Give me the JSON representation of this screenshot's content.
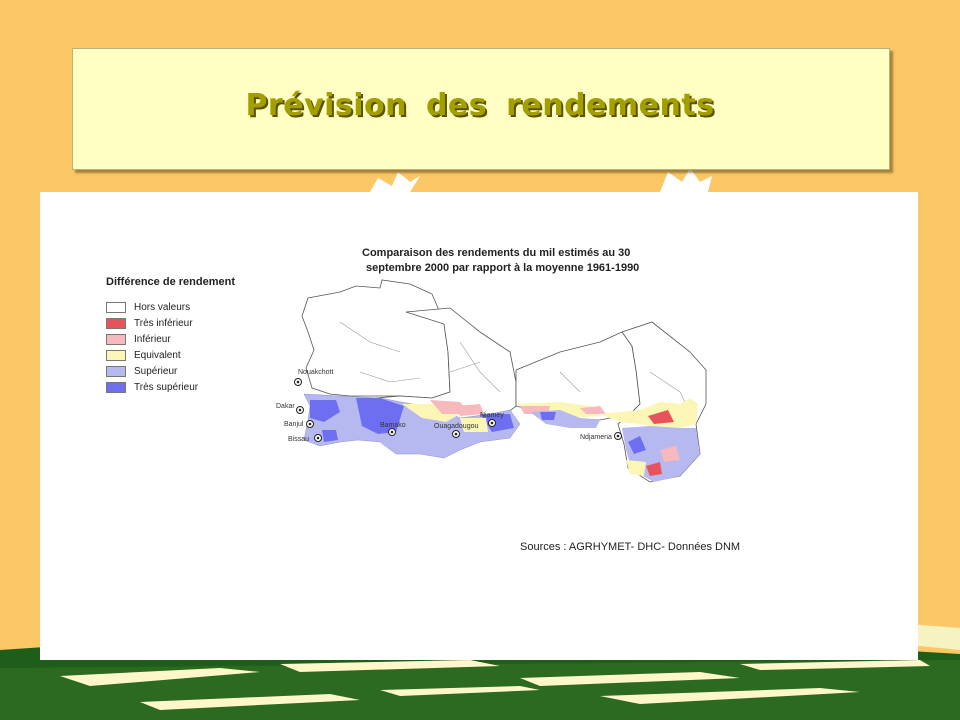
{
  "slide": {
    "title": "Prévision des rendements"
  },
  "map": {
    "title_line1": "Comparaison des rendements du mil estimés au 30",
    "title_line2": "septembre 2000 par rapport à la moyenne 1961-1990",
    "legend_title": "Différence de rendement",
    "legend": [
      {
        "label": "Hors valeurs",
        "color": "#ffffff"
      },
      {
        "label": "Très inférieur",
        "color": "#e8525a"
      },
      {
        "label": "Inférieur",
        "color": "#f7b9bd"
      },
      {
        "label": "Equivalent",
        "color": "#fbf6b6"
      },
      {
        "label": "Supérieur",
        "color": "#b6b9ef"
      },
      {
        "label": "Très supérieur",
        "color": "#6e6ff0"
      }
    ],
    "cities": {
      "nouakchott": "Nouakchott",
      "dakar": "Dakar",
      "banjul": "Banjul",
      "bissau": "Bissau",
      "bamako": "Bamako",
      "ouagadougou": "Ouagadougou",
      "niamey": "Niamey",
      "ndjamena": "Ndjamena"
    },
    "sources": "Sources : AGRHYMET- DHC- Données DNM"
  }
}
